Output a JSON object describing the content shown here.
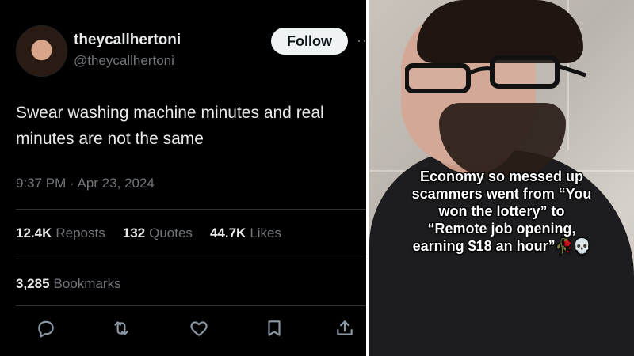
{
  "tweet": {
    "display_name": "theycallhertoni",
    "handle": "@theycallhertoni",
    "follow_label": "Follow",
    "more_label": "··",
    "text_line1": "Swear washing machine minutes and real",
    "text_line2": "minutes are not the same",
    "timestamp": "9:37 PM · Apr 23, 2024",
    "stats": [
      {
        "value": "12.4K",
        "label": "Reposts"
      },
      {
        "value": "132",
        "label": "Quotes"
      },
      {
        "value": "44.7K",
        "label": "Likes"
      }
    ],
    "bookmarks": {
      "value": "3,285",
      "label": "Bookmarks"
    },
    "actions": [
      "reply-icon",
      "repost-icon",
      "like-icon",
      "bookmark-icon",
      "share-icon"
    ]
  },
  "photo": {
    "caption_line1": "Economy so messed up",
    "caption_line2": "scammers went from “You",
    "caption_line3": "won the lottery” to",
    "caption_line4": "“Remote job opening,",
    "caption_line5": "earning $18 an hour”🥀💀"
  },
  "colors": {
    "background": "#000000",
    "primary_text": "#e7e9ea",
    "secondary_text": "#71767b",
    "follow_bg": "#eff3f4"
  }
}
